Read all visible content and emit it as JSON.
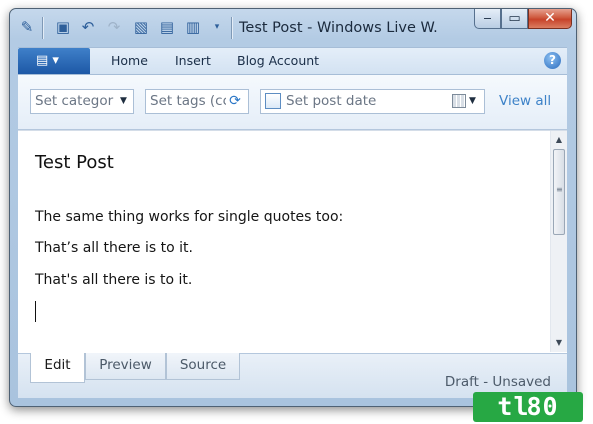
{
  "window": {
    "title": "Test Post - Windows Live W...",
    "quick_access_icons": [
      "pen-icon",
      "save-icon",
      "undo-icon",
      "redo-icon",
      "new-post-icon",
      "open-post-icon",
      "edit-draft-icon",
      "customize-dropdown-icon"
    ],
    "caption": {
      "minimize": "‒",
      "maximize": "▭",
      "close": "✕"
    }
  },
  "ribbon": {
    "app_menu_glyph": "▤ ▾",
    "tabs": [
      {
        "label": "Home"
      },
      {
        "label": "Insert"
      },
      {
        "label": "Blog Account"
      }
    ],
    "help_glyph": "?"
  },
  "properties": {
    "category_placeholder": "Set categor",
    "tags_placeholder": "Set tags (cc",
    "post_date_placeholder": "Set post date",
    "view_all_label": "View all"
  },
  "editor": {
    "post_title": "Test Post",
    "paragraphs": [
      "The same thing works for single quotes too:",
      "That’s all there is to it.",
      "That's all there is to it."
    ],
    "scroll_position": 0
  },
  "bottom": {
    "tabs": [
      {
        "label": "Edit",
        "active": true
      },
      {
        "label": "Preview",
        "active": false
      },
      {
        "label": "Source",
        "active": false
      }
    ],
    "status": "Draft - Unsaved"
  },
  "watermark": {
    "text": "tl80"
  },
  "colors": {
    "ribbon_accent": "#1d58a6",
    "link_blue": "#3d82c8",
    "close_button": "#c7432a",
    "watermark_green": "#27a844"
  }
}
